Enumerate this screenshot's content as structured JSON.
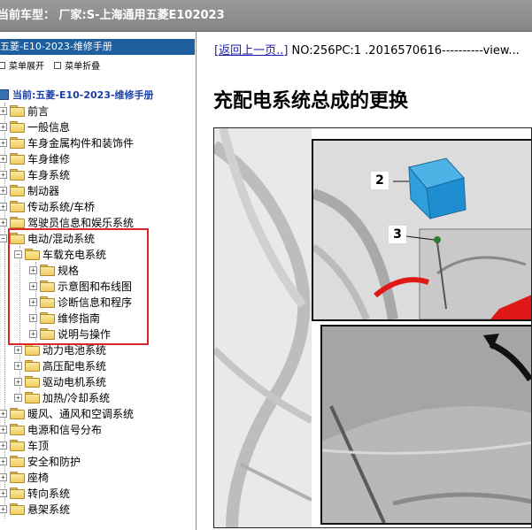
{
  "window": {
    "title": "当前车型： 厂家:S-上海通用五菱E102023"
  },
  "left_pane": {
    "title": "五菱-E10-2023-维修手册",
    "tools": {
      "expand_label": "菜单展开",
      "collapse_label": "菜单折叠"
    },
    "root_label": "当前:五菱-E10-2023-维修手册",
    "tree": [
      {
        "label": "前言",
        "level": 0,
        "expander": "+"
      },
      {
        "label": "一般信息",
        "level": 0,
        "expander": "+"
      },
      {
        "label": "车身金属构件和装饰件",
        "level": 0,
        "expander": "+"
      },
      {
        "label": "车身维修",
        "level": 0,
        "expander": "+"
      },
      {
        "label": "车身系统",
        "level": 0,
        "expander": "+"
      },
      {
        "label": "制动器",
        "level": 0,
        "expander": "+"
      },
      {
        "label": "传动系统/车桥",
        "level": 0,
        "expander": "+"
      },
      {
        "label": "驾驶员信息和娱乐系统",
        "level": 0,
        "expander": "+"
      },
      {
        "label": "电动/混动系统",
        "level": 0,
        "expander": "−"
      },
      {
        "label": "车载充电系统",
        "level": 1,
        "expander": "−"
      },
      {
        "label": "规格",
        "level": 2,
        "expander": "+"
      },
      {
        "label": "示意图和布线图",
        "level": 2,
        "expander": "+"
      },
      {
        "label": "诊断信息和程序",
        "level": 2,
        "expander": "+"
      },
      {
        "label": "维修指南",
        "level": 2,
        "expander": "+"
      },
      {
        "label": "说明与操作",
        "level": 2,
        "expander": "+"
      },
      {
        "label": "动力电池系统",
        "level": 1,
        "expander": "+"
      },
      {
        "label": "高压配电系统",
        "level": 1,
        "expander": "+"
      },
      {
        "label": "驱动电机系统",
        "level": 1,
        "expander": "+"
      },
      {
        "label": "加热/冷却系统",
        "level": 1,
        "expander": "+"
      },
      {
        "label": "暖风、通风和空调系统",
        "level": 0,
        "expander": "+"
      },
      {
        "label": "电源和信号分布",
        "level": 0,
        "expander": "+"
      },
      {
        "label": "车顶",
        "level": 0,
        "expander": "+"
      },
      {
        "label": "安全和防护",
        "level": 0,
        "expander": "+"
      },
      {
        "label": "座椅",
        "level": 0,
        "expander": "+"
      },
      {
        "label": "转向系统",
        "level": 0,
        "expander": "+"
      },
      {
        "label": "悬架系统",
        "level": 0,
        "expander": "+"
      }
    ]
  },
  "content": {
    "back_link": "[返回上一页..]",
    "doc_info": " NO:256PC:1 .2016570616----------view...",
    "heading": "充配电系统总成的更换",
    "figure": {
      "callouts": [
        "2",
        "3"
      ]
    }
  },
  "colors": {
    "highlight_box": "#e02525",
    "title_bar": "#1f5fa0",
    "link": "#1b1bb0"
  }
}
